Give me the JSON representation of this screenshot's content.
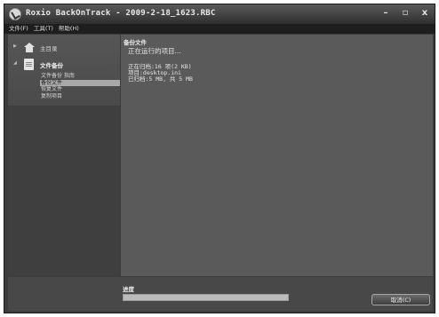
{
  "window": {
    "title": "Roxio BackOnTrack - 2009-2-18_1623.RBC",
    "controls": {
      "minimize": "–",
      "restore": "▫",
      "close": "x"
    }
  },
  "menubar": [
    "文件(F)",
    "工具(T)",
    "帮助(H)"
  ],
  "sidebar": {
    "home": {
      "label": "主目录",
      "icon": "home-icon"
    },
    "backup": {
      "label": "文件备份",
      "icon": "file-backup-icon",
      "items": [
        "文件备份 指南",
        "备份文件",
        "恢复文件",
        "复制项目"
      ],
      "selected_index": 1
    }
  },
  "main": {
    "title": "备份文件",
    "running_text": "正在运行的项目...",
    "status_lines": [
      "正在归档:16 项(2 KB)",
      "项目:desktop.ini",
      "已归档:5 MB, 共 5 MB"
    ]
  },
  "footer": {
    "progress_label": "进度",
    "progress_value": 1.0,
    "cancel_label": "取消(C)"
  }
}
